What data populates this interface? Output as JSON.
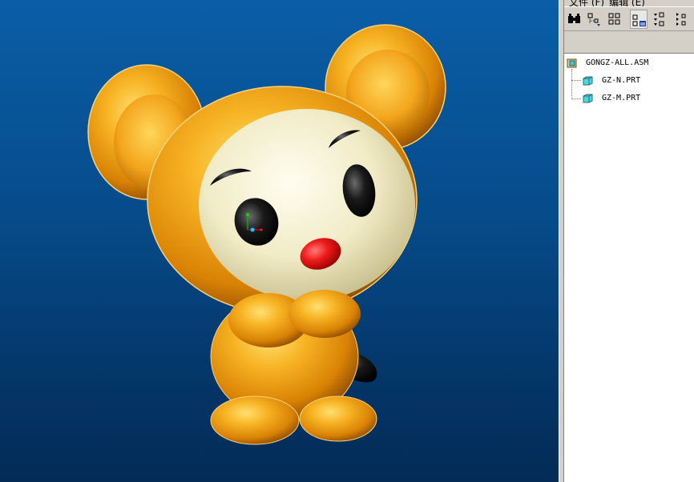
{
  "menu": {
    "items": [
      "文件 (F)",
      "编辑 (E)"
    ]
  },
  "toolbar": {
    "buttons": [
      {
        "icon": "binoculars-icon"
      },
      {
        "icon": "tree-settings-icon"
      },
      {
        "icon": "tree-columns-icon"
      },
      {
        "icon": "show-layers-icon"
      },
      {
        "icon": "expand-all-icon"
      },
      {
        "icon": "collapse-all-icon"
      }
    ]
  },
  "model_tree": {
    "root": {
      "label": "GONGZ-ALL.ASM",
      "icon": "assembly-icon"
    },
    "children": [
      {
        "label": "GZ-N.PRT",
        "icon": "part-icon"
      },
      {
        "label": "GZ-M.PRT",
        "icon": "part-icon"
      }
    ]
  },
  "colors": {
    "viewport_top": "#0a5ea7",
    "viewport_bottom": "#032b56",
    "model_orange": "#f2a412",
    "face_cream": "#f4efcf",
    "nose_red": "#e8141a",
    "panel_gray": "#d4d0c8"
  }
}
